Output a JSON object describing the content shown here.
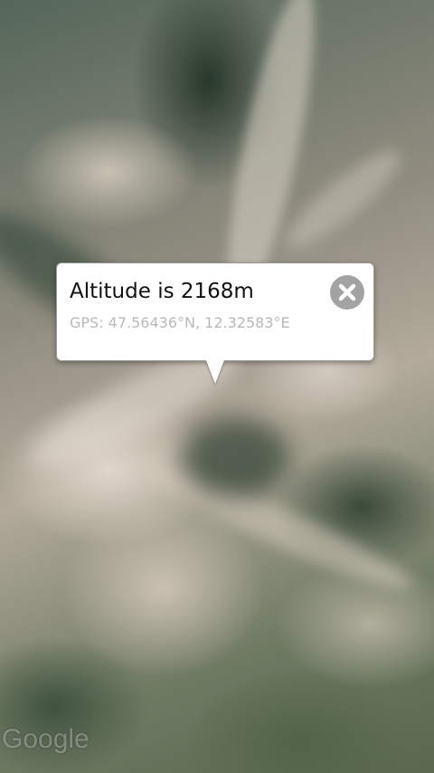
{
  "map": {
    "type": "satellite",
    "attribution_logo": "Google"
  },
  "info_bubble": {
    "title": "Altitude is 2168m",
    "subtitle": "GPS: 47.56436°N, 12.32583°E",
    "close_icon": "close-icon",
    "colors": {
      "background": "#ffffff",
      "title": "#111111",
      "subtitle": "#b9b9b9",
      "close_button": "#a3a3a3"
    }
  }
}
